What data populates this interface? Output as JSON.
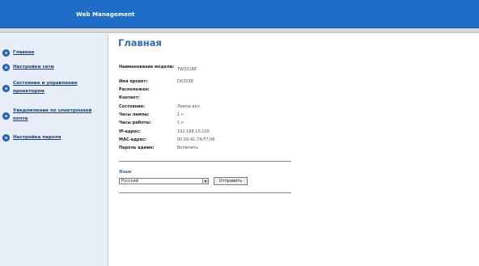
{
  "header": {
    "title": "Web Management"
  },
  "sidebar": {
    "items": [
      {
        "label": "Главная"
      },
      {
        "label": "Настройки сети"
      },
      {
        "label": "Состояние и управление проектором"
      },
      {
        "label": "Уведомление по электронной почте"
      },
      {
        "label": "Настройка пароля"
      }
    ]
  },
  "main": {
    "title": "Главная",
    "info": [
      {
        "label": "Наименование модели:",
        "value": "TW331RE"
      },
      {
        "label": "Имя проект:",
        "value": "D63238"
      },
      {
        "label": "Расположен:",
        "value": ""
      },
      {
        "label": "Контакт:",
        "value": ""
      },
      {
        "label": "Состояние:",
        "value": "Лампа вкл."
      },
      {
        "label": "Часы лампы:",
        "value": "1 ч"
      },
      {
        "label": "Часы работы:",
        "value": "1 ч"
      },
      {
        "label": "IP-адрес:",
        "value": "192.168.10.100"
      },
      {
        "label": "MAC-адрес:",
        "value": "00:50:41:7A:F7:06"
      },
      {
        "label": "Пароль админ:",
        "value": "Включить"
      }
    ],
    "language": {
      "label": "Язык",
      "selected": "Русский",
      "submit_label": "Отправить"
    }
  },
  "colors": {
    "header_bg": "#1e6ec8",
    "sidebar_bg": "#e8eef8",
    "accent": "#2d6dbb",
    "link": "#1a3f7a"
  },
  "icons": {
    "nav_bullet": "arrow-right-circle-icon",
    "select_arrow": "chevron-down-icon"
  }
}
